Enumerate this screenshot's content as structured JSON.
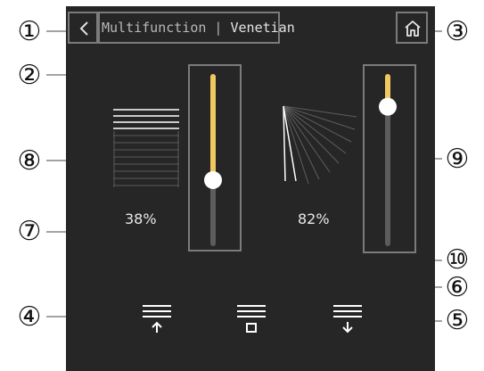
{
  "header": {
    "title_part1": "Multifunction",
    "title_part2": "Venetian"
  },
  "sliders": {
    "tilt": {
      "percent_label": "38%",
      "level": 0.62
    },
    "position": {
      "percent_label": "82%",
      "level": 0.18
    }
  },
  "controls": {
    "up_icon": "lines-with-up-arrow-icon",
    "stop_icon": "lines-with-square-icon",
    "down_icon": "lines-with-down-arrow-icon"
  },
  "callouts": [
    "①",
    "②",
    "③",
    "④",
    "⑤",
    "⑥",
    "⑦",
    "⑧",
    "⑨",
    "⑩"
  ],
  "colors": {
    "screen_bg": "#262626",
    "accent": "#f0c860",
    "outline": "#7b7b7b",
    "text": "#e8e8e8"
  }
}
